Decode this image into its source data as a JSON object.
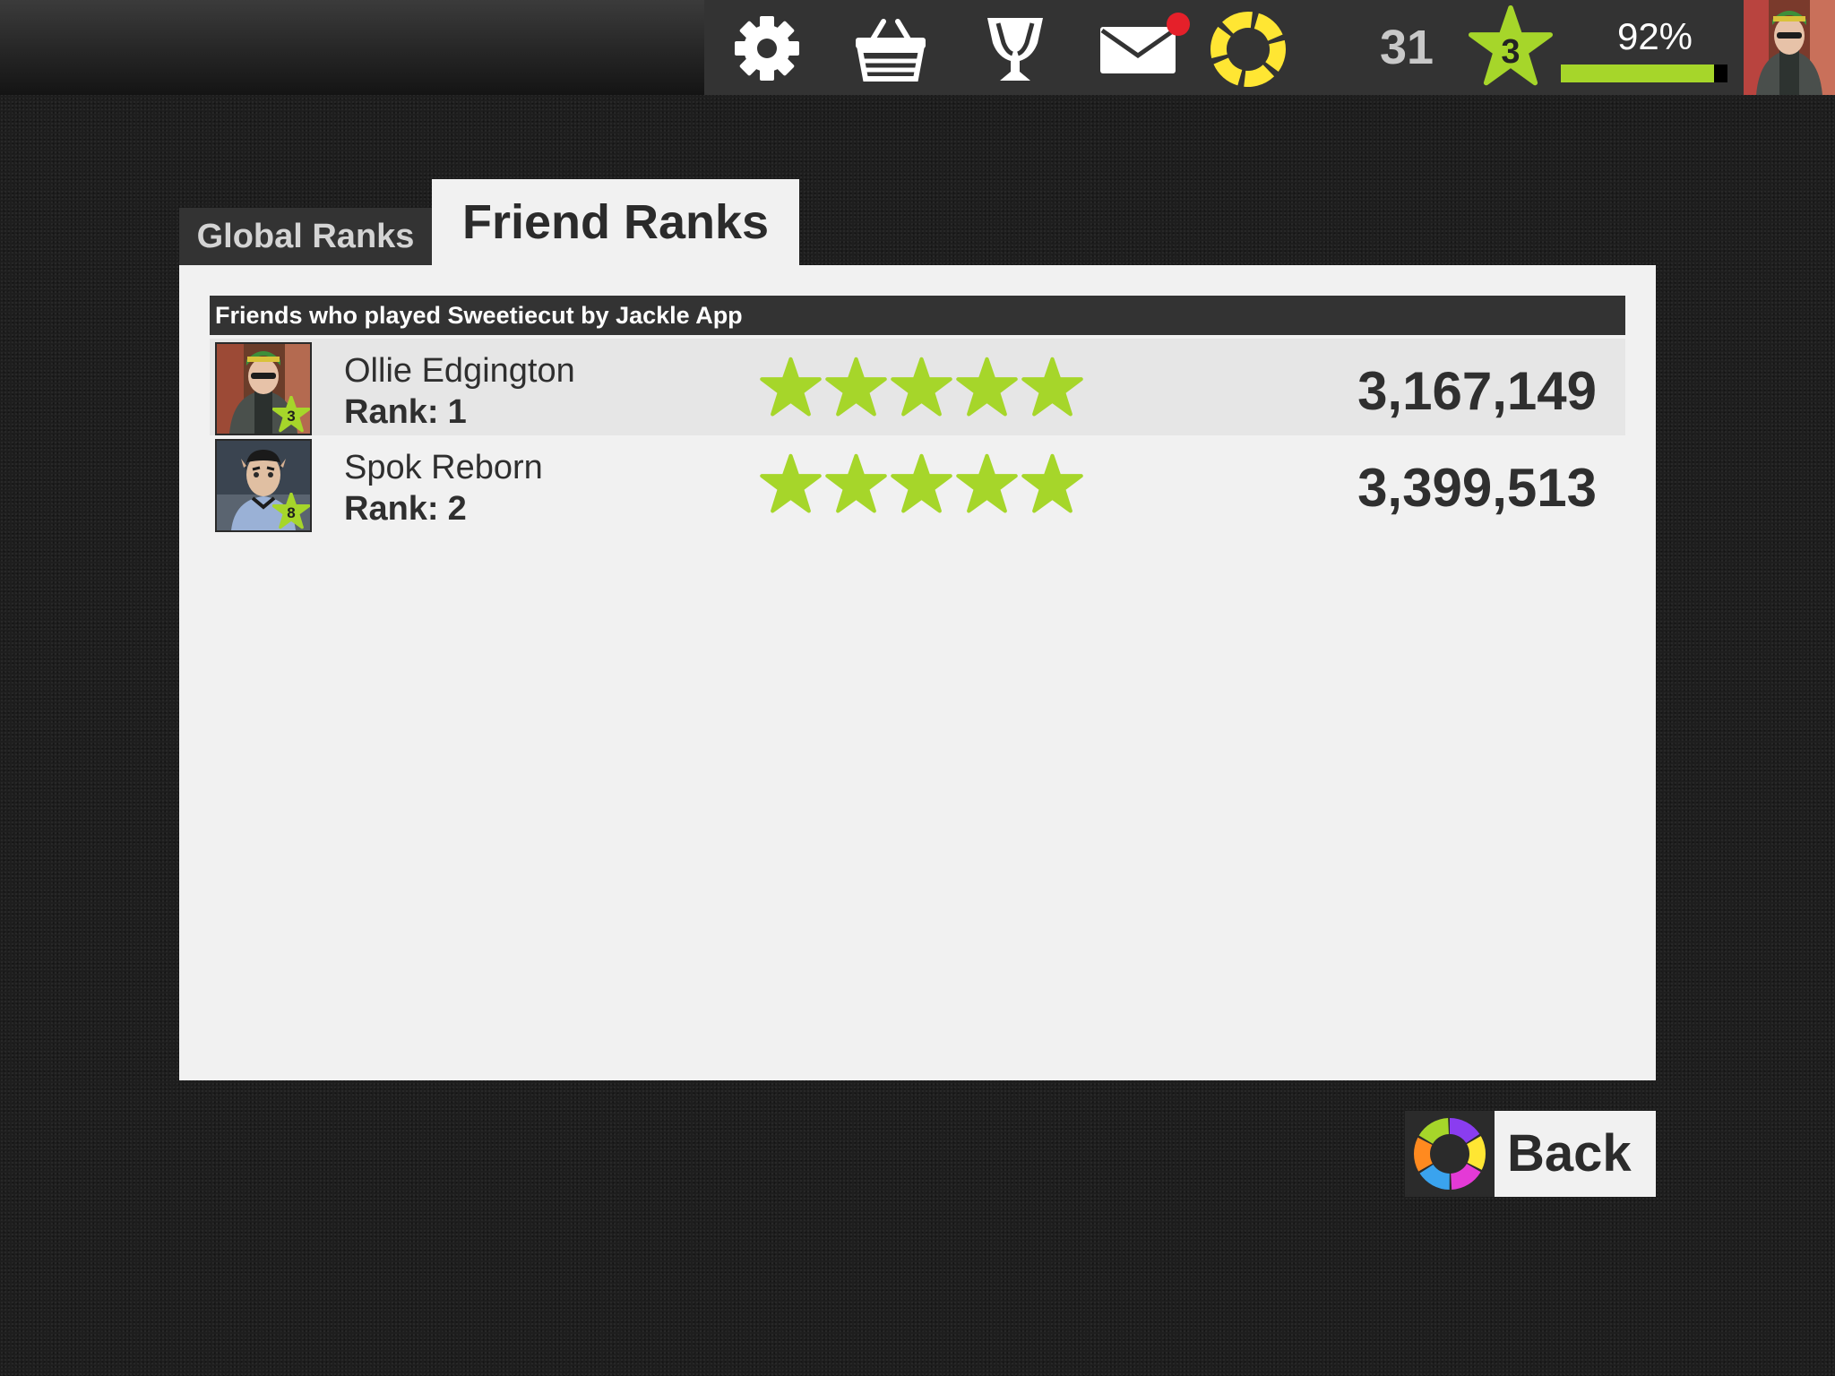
{
  "topbar": {
    "icons": [
      "settings-icon",
      "shop-basket-icon",
      "trophy-icon",
      "mail-icon",
      "color-ring-icon"
    ],
    "mail_has_notification": true,
    "level_count": "31",
    "player_level": "3",
    "xp_percent_label": "92%",
    "xp_fraction": 0.92
  },
  "tabs": {
    "global": "Global Ranks",
    "friend": "Friend Ranks",
    "active": "friend"
  },
  "list": {
    "header": "Friends who played Sweetiecut by Jackle App",
    "rank_label": "Rank:",
    "rows": [
      {
        "name": "Ollie Edgington",
        "rank": "1",
        "level": "3",
        "stars": 5,
        "score": "3,167,149"
      },
      {
        "name": "Spok Reborn",
        "rank": "2",
        "level": "8",
        "stars": 5,
        "score": "3,399,513"
      }
    ]
  },
  "back_button": {
    "label": "Back"
  },
  "colors": {
    "accent_green": "#a6d62a",
    "dark_bar": "#333333",
    "panel": "#f1f1f1",
    "notification_red": "#e5202a",
    "ring_yellow": "#ffe633"
  }
}
